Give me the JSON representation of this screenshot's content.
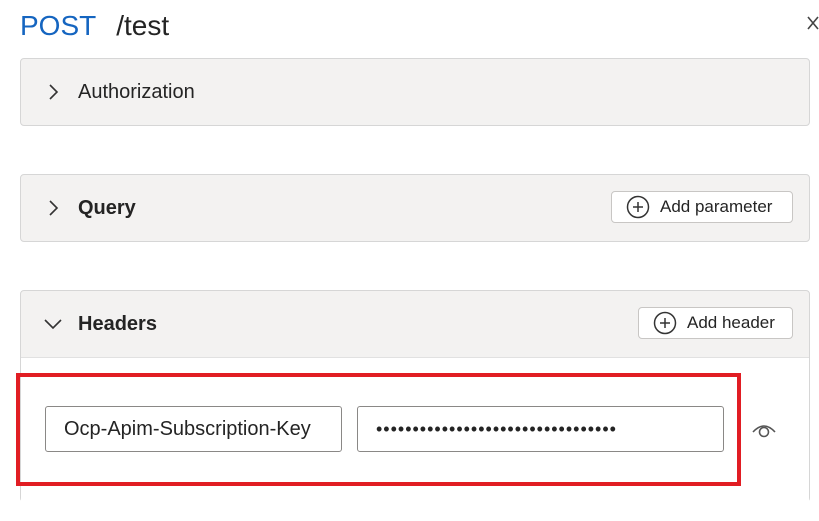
{
  "header": {
    "method": "POST",
    "path": "/test"
  },
  "sections": {
    "authorization": {
      "label": "Authorization",
      "expanded": false
    },
    "query": {
      "label": "Query",
      "expanded": false,
      "add_button": "Add parameter"
    },
    "headers": {
      "label": "Headers",
      "expanded": true,
      "add_button": "Add header",
      "rows": [
        {
          "name": "Ocp-Apim-Subscription-Key",
          "value": "•••••••••••••••••••••••••••••••••"
        }
      ]
    }
  },
  "colors": {
    "method": "#1565c0",
    "highlight": "#e11d23",
    "panel_bg": "#f3f2f1"
  }
}
